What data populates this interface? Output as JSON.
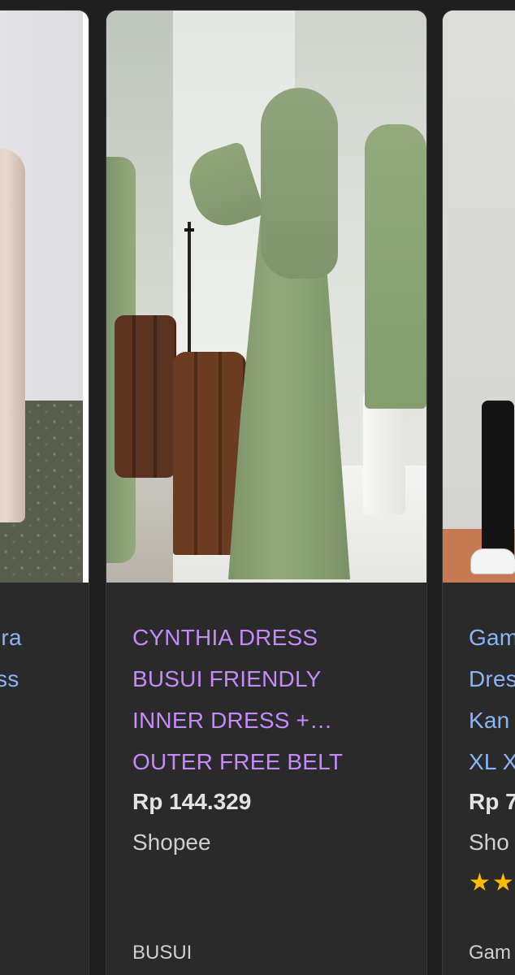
{
  "cards": [
    {
      "title_lines": [
        "ira",
        "ss"
      ]
    },
    {
      "title_lines": [
        "CYNTHIA DRESS",
        "BUSUI FRIENDLY",
        "INNER DRESS +…",
        "OUTER FREE BELT"
      ],
      "price": "Rp 144.329",
      "store": "Shopee",
      "tag": "BUSUI"
    },
    {
      "title_lines": [
        "Gam",
        "Dres",
        "Kan",
        "XL X"
      ],
      "price": "Rp 7",
      "store": "Sho",
      "rating_icon": "star-icon",
      "rating_glyphs": "★★",
      "tag": "Gam"
    }
  ]
}
